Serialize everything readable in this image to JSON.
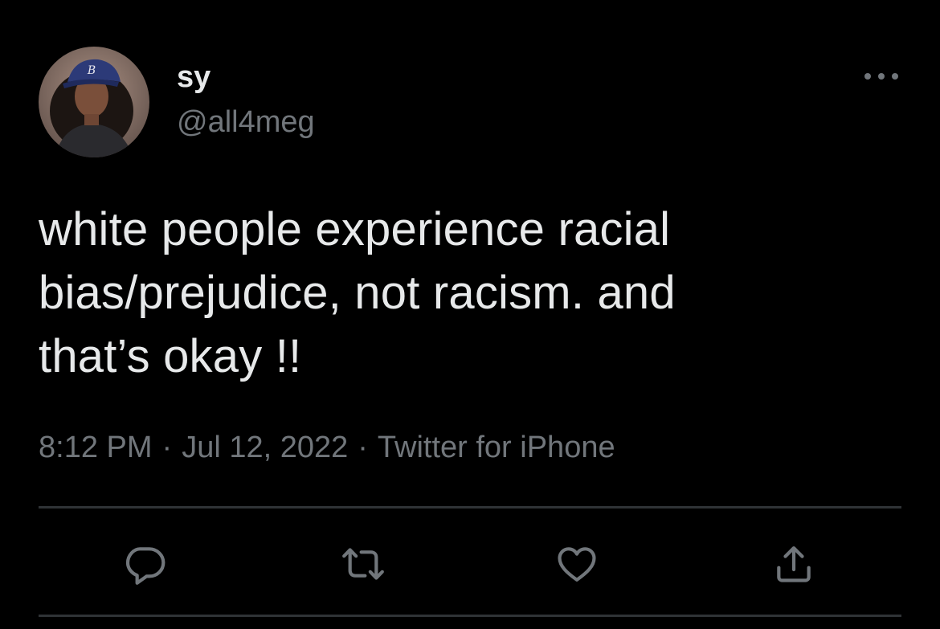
{
  "user": {
    "display_name": "sy",
    "handle": "@all4meg",
    "avatar_icon": "profile-photo"
  },
  "tweet": {
    "text": "white people experience racial\nbias/prejudice, not racism. and\nthat’s okay !!"
  },
  "meta": {
    "time": "8:12 PM",
    "separator": "·",
    "date": "Jul 12, 2022",
    "source": "Twitter for iPhone"
  },
  "actions": [
    {
      "icon": "reply-icon"
    },
    {
      "icon": "retweet-icon"
    },
    {
      "icon": "like-icon"
    },
    {
      "icon": "share-icon"
    }
  ],
  "colors": {
    "background": "#000000",
    "primary_text": "#e7e9ea",
    "secondary_text": "#71767b",
    "divider": "#2f3336"
  }
}
